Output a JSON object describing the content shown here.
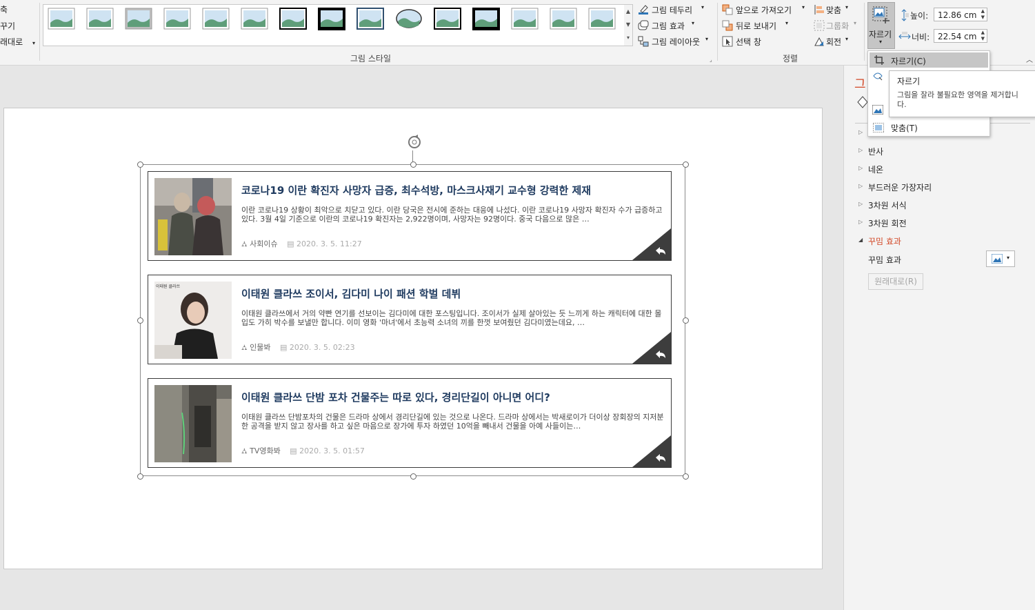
{
  "ribbon": {
    "left_partial": [
      "축",
      "꾸기",
      "래대로"
    ],
    "group_picture_style_label": "그림 스타일",
    "border_btn": "그림 테두리",
    "effects_btn": "그림 효과",
    "layout_btn": "그림 레이아웃",
    "bring_forward": "앞으로 가져오기",
    "send_backward": "뒤로 보내기",
    "selection_pane": "선택 창",
    "align": "맞춤",
    "group": "그룹화",
    "rotate": "회전",
    "arrange_label": "정렬",
    "crop": "자르기",
    "height_label": "높이:",
    "height_value": "12.86 cm",
    "width_label": "너비:",
    "width_value": "22.54 cm",
    "picture_styles_count": 15
  },
  "dropdown": {
    "crop_item": "자르기(C)",
    "fit_item": "맞춤(T)"
  },
  "tooltip": {
    "title": "자르기",
    "body": "그림을 잘라 불필요한 영역을 제거합니다."
  },
  "format_pane": {
    "title_partial": "그",
    "items": [
      "반사",
      "네온",
      "부드러운 가장자리",
      "3차원 서식",
      "3차원 회전"
    ],
    "expanded": "꾸밈 효과",
    "artistic_label": "꾸밈 효과",
    "reset_btn": "원래대로(R)"
  },
  "cards": [
    {
      "title": "코로나19 이란 확진자 사망자 급증, 최수석방, 마스크사재기 교수형 강력한 제재",
      "desc": "이란 코로나19 상황이 최악으로 치닫고 있다. 이란 당국은 전시에 준하는 대응에 나섰다. 이란 코로나19 사망자 확진자 수가 급증하고 있다. 3월 4일 기준으로 이란의 코로나19 확진자는 2,922명이며, 사망자는 92명이다. 중국 다음으로 많은 …",
      "category": "사회이슈",
      "date": "2020. 3. 5. 11:27"
    },
    {
      "title": "이태원 클라쓰 조이서, 김다미 나이 패션 학벌 데뷔",
      "desc": "이태원 클라쓰에서 거의 약빤 연기를 선보이는 김다미에 대한 포스팅입니다. 조이서가 실제 살아있는 듯 느끼게 하는 캐릭터에 대한 몰입도 가히 박수를 보낼만 합니다. 이미 영화 '마녀'에서 초능력 소녀의 끼를 한껏 보여줬던 김다미였는데요, …",
      "category": "인물봐",
      "date": "2020. 3. 5. 02:23",
      "photo_caption": "이태원 클라쓰"
    },
    {
      "title": "이태원 클라쓰 단밤 포차 건물주는 따로 있다, 경리단길이 아니면 어디?",
      "desc": "이태원 클라쓰 단밤포차의 건물은 드라마 상에서 경리단길에 있는 것으로 나온다. 드라마 상에서는 박새로이가 더이상 장회장의 지저분한 공격을 받지 않고 장사를 하고 싶은 마음으로 장가에 투자 하였던 10억을 빼내서 건물을 아예 사들이는…",
      "category": "TV영화봐",
      "date": "2020. 3. 5. 01:57"
    }
  ]
}
